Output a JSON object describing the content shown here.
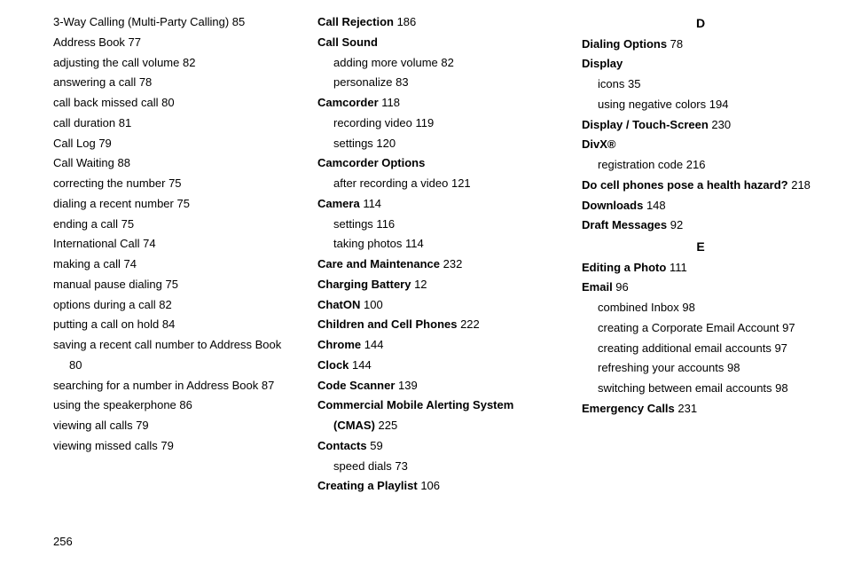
{
  "pageNumber": "256",
  "columns": [
    [
      {
        "type": "entry",
        "text": "3-Way Calling (Multi-Party Calling)",
        "page": "85"
      },
      {
        "type": "entry",
        "text": "Address Book",
        "page": "77"
      },
      {
        "type": "entry",
        "text": "adjusting the call volume",
        "page": "82"
      },
      {
        "type": "entry",
        "text": "answering a call",
        "page": "78"
      },
      {
        "type": "entry",
        "text": "call back missed call",
        "page": "80"
      },
      {
        "type": "entry",
        "text": "call duration",
        "page": "81"
      },
      {
        "type": "entry",
        "text": "Call Log",
        "page": "79"
      },
      {
        "type": "entry",
        "text": "Call Waiting",
        "page": "88"
      },
      {
        "type": "entry",
        "text": "correcting the number",
        "page": "75"
      },
      {
        "type": "entry",
        "text": "dialing a recent number",
        "page": "75"
      },
      {
        "type": "entry",
        "text": "ending a call",
        "page": "75"
      },
      {
        "type": "entry",
        "text": "International Call",
        "page": "74"
      },
      {
        "type": "entry",
        "text": "making a call",
        "page": "74"
      },
      {
        "type": "entry",
        "text": "manual pause dialing",
        "page": "75"
      },
      {
        "type": "entry",
        "text": "options during a call",
        "page": "82"
      },
      {
        "type": "entry",
        "text": "putting a call on hold",
        "page": "84"
      },
      {
        "type": "entry",
        "text": "saving a recent call number to Address Book",
        "page": "80"
      },
      {
        "type": "entry",
        "text": "searching for a number in Address Book",
        "page": "87"
      },
      {
        "type": "entry",
        "text": "using the speakerphone",
        "page": "86"
      },
      {
        "type": "entry",
        "text": "viewing all calls",
        "page": "79"
      },
      {
        "type": "entry",
        "text": "viewing missed calls",
        "page": "79"
      }
    ],
    [
      {
        "type": "entry",
        "bold": true,
        "text": "Call Rejection",
        "page": "186"
      },
      {
        "type": "entry",
        "bold": true,
        "text": "Call Sound"
      },
      {
        "type": "sub",
        "text": "adding more volume",
        "page": "82"
      },
      {
        "type": "sub",
        "text": "personalize",
        "page": "83"
      },
      {
        "type": "entry",
        "bold": true,
        "text": "Camcorder",
        "page": "118"
      },
      {
        "type": "sub",
        "text": "recording video",
        "page": "119"
      },
      {
        "type": "sub",
        "text": "settings",
        "page": "120"
      },
      {
        "type": "entry",
        "bold": true,
        "text": "Camcorder Options"
      },
      {
        "type": "sub",
        "text": "after recording a video",
        "page": "121"
      },
      {
        "type": "entry",
        "bold": true,
        "text": "Camera",
        "page": "114"
      },
      {
        "type": "sub",
        "text": "settings",
        "page": "116"
      },
      {
        "type": "sub",
        "text": "taking photos",
        "page": "114"
      },
      {
        "type": "entry",
        "bold": true,
        "text": "Care and Maintenance",
        "page": "232"
      },
      {
        "type": "entry",
        "bold": true,
        "text": "Charging Battery",
        "page": "12"
      },
      {
        "type": "entry",
        "bold": true,
        "text": "ChatON",
        "page": "100"
      },
      {
        "type": "entry",
        "bold": true,
        "text": "Children and Cell Phones",
        "page": "222"
      },
      {
        "type": "entry",
        "bold": true,
        "text": "Chrome",
        "page": "144"
      },
      {
        "type": "entry",
        "bold": true,
        "text": "Clock",
        "page": "144"
      },
      {
        "type": "entry",
        "bold": true,
        "text": "Code Scanner",
        "page": "139"
      },
      {
        "type": "entry",
        "bold": true,
        "text": "Commercial Mobile Alerting System (CMAS)",
        "page": "225"
      },
      {
        "type": "entry",
        "bold": true,
        "text": "Contacts",
        "page": "59"
      },
      {
        "type": "sub",
        "text": "speed dials",
        "page": "73"
      },
      {
        "type": "entry",
        "bold": true,
        "text": "Creating a Playlist",
        "page": "106"
      }
    ],
    [
      {
        "type": "section",
        "text": "D"
      },
      {
        "type": "entry",
        "bold": true,
        "text": "Dialing Options",
        "page": "78"
      },
      {
        "type": "entry",
        "bold": true,
        "text": "Display"
      },
      {
        "type": "sub",
        "text": "icons",
        "page": "35"
      },
      {
        "type": "sub",
        "text": "using negative colors",
        "page": "194"
      },
      {
        "type": "entry",
        "bold": true,
        "text": "Display / Touch-Screen",
        "page": "230"
      },
      {
        "type": "entry",
        "bold": true,
        "text": "DivX®"
      },
      {
        "type": "sub",
        "text": "registration code",
        "page": "216"
      },
      {
        "type": "entry",
        "bold": true,
        "text": "Do cell phones pose a health hazard?",
        "page": "218"
      },
      {
        "type": "entry",
        "bold": true,
        "text": "Downloads",
        "page": "148"
      },
      {
        "type": "entry",
        "bold": true,
        "text": "Draft Messages",
        "page": "92"
      },
      {
        "type": "section",
        "text": "E"
      },
      {
        "type": "entry",
        "bold": true,
        "text": "Editing a Photo",
        "page": "111"
      },
      {
        "type": "entry",
        "bold": true,
        "text": "Email",
        "page": "96"
      },
      {
        "type": "sub",
        "text": "combined Inbox",
        "page": "98"
      },
      {
        "type": "sub",
        "text": "creating a Corporate Email Account",
        "page": "97"
      },
      {
        "type": "sub",
        "text": "creating additional email accounts",
        "page": "97"
      },
      {
        "type": "sub",
        "text": "refreshing your accounts",
        "page": "98"
      },
      {
        "type": "sub",
        "text": "switching between email accounts",
        "page": "98"
      },
      {
        "type": "entry",
        "bold": true,
        "text": "Emergency Calls",
        "page": "231"
      }
    ]
  ]
}
